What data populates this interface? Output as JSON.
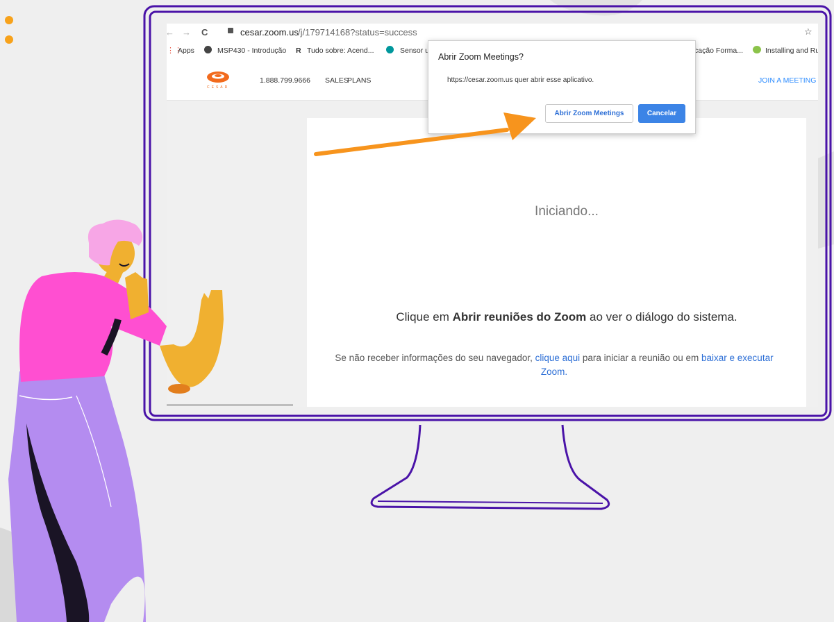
{
  "browser": {
    "url_host": "cesar.zoom.us",
    "url_path": "/j/179714168?status=success",
    "bookmarks": [
      "Apps",
      "MSP430 - Introdução",
      "Tudo sobre: Acend...",
      "Sensor u",
      "cação Forma...",
      "Installing and Ru"
    ]
  },
  "site": {
    "logo_text": "CESAR",
    "phone": "1.888.799.9666",
    "nav_sales": "SALES",
    "nav_plans": "PLANS",
    "join": "JOIN A MEETING"
  },
  "dialog": {
    "title": "Abrir Zoom Meetings?",
    "message": "https://cesar.zoom.us quer abrir esse aplicativo.",
    "open_button": "Abrir Zoom Meetings",
    "cancel_button": "Cancelar"
  },
  "page": {
    "status": "Iniciando...",
    "instr_pre": "Clique em ",
    "instr_bold": "Abrir reuniões do Zoom",
    "instr_post": " ao ver o diálogo do sistema.",
    "help_pre": "Se não receber informações do seu navegador, ",
    "help_link1": "clique aqui",
    "help_mid": " para iniciar a reunião ou em ",
    "help_link2": "baixar e executar",
    "help_link3": "Zoom",
    "help_end": "."
  },
  "colors": {
    "monitor": "#4a13a8",
    "arrow": "#f7941d",
    "accent_blue": "#2d8cff",
    "cancel_blue": "#3c84e6"
  }
}
